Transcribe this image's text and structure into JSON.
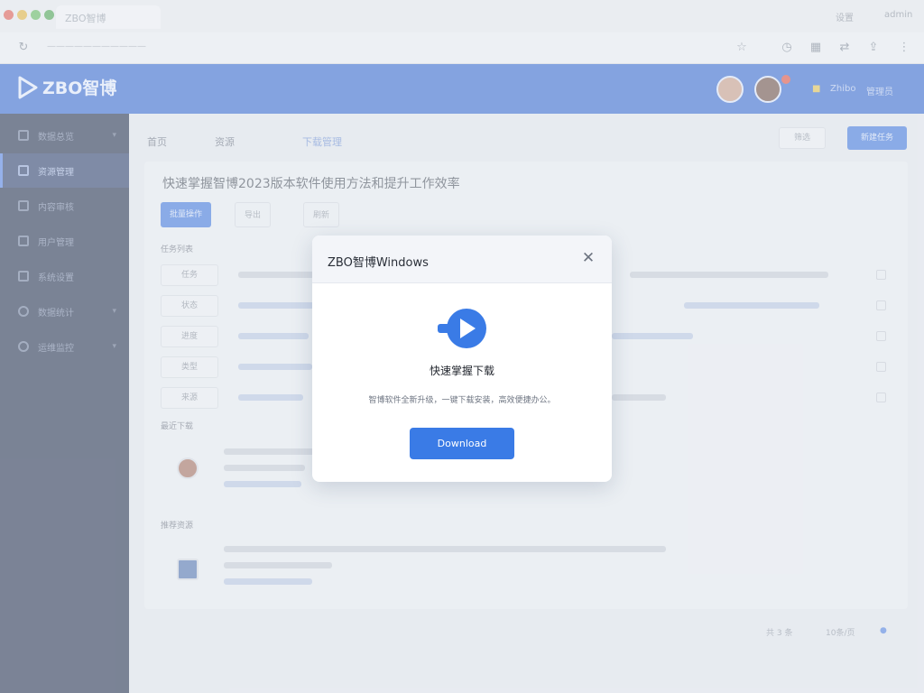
{
  "browser": {
    "tab_title": "ZBO智博",
    "right_labels": [
      "设置",
      "admin"
    ]
  },
  "header": {
    "logo_text": "ZBO智博",
    "user_label": "Zhibo",
    "user_role": "管理员"
  },
  "sidebar": {
    "items": [
      {
        "label": "数据总览"
      },
      {
        "label": "资源管理"
      },
      {
        "label": "内容审核"
      },
      {
        "label": "用户管理"
      },
      {
        "label": "系统设置"
      },
      {
        "label": "数据统计"
      },
      {
        "label": "运维监控"
      }
    ]
  },
  "main": {
    "breadcrumb": [
      "首页",
      "资源",
      "下载管理"
    ],
    "filter_label": "筛选",
    "primary_action": "新建任务",
    "page_title": "快速掌握智博2023版本软件使用方法和提升工作效率",
    "toolbar": [
      "批量操作",
      "导出",
      "刷新"
    ],
    "sections": [
      "任务列表",
      "最近下载",
      "推荐资源"
    ],
    "row_labels": [
      "任务",
      "状态",
      "进度",
      "类型",
      "来源"
    ],
    "pager": [
      "共 3 条",
      "10条/页"
    ]
  },
  "dialog": {
    "title": "ZBO智博Windows",
    "heading": "快速掌握下载",
    "description": "智博软件全新升级，一键下载安装，高效便捷办公。",
    "button_label": "Download"
  },
  "colors": {
    "brand": "#3064cf",
    "sidebar": "#1e2a48",
    "accent": "#3a7be6"
  }
}
